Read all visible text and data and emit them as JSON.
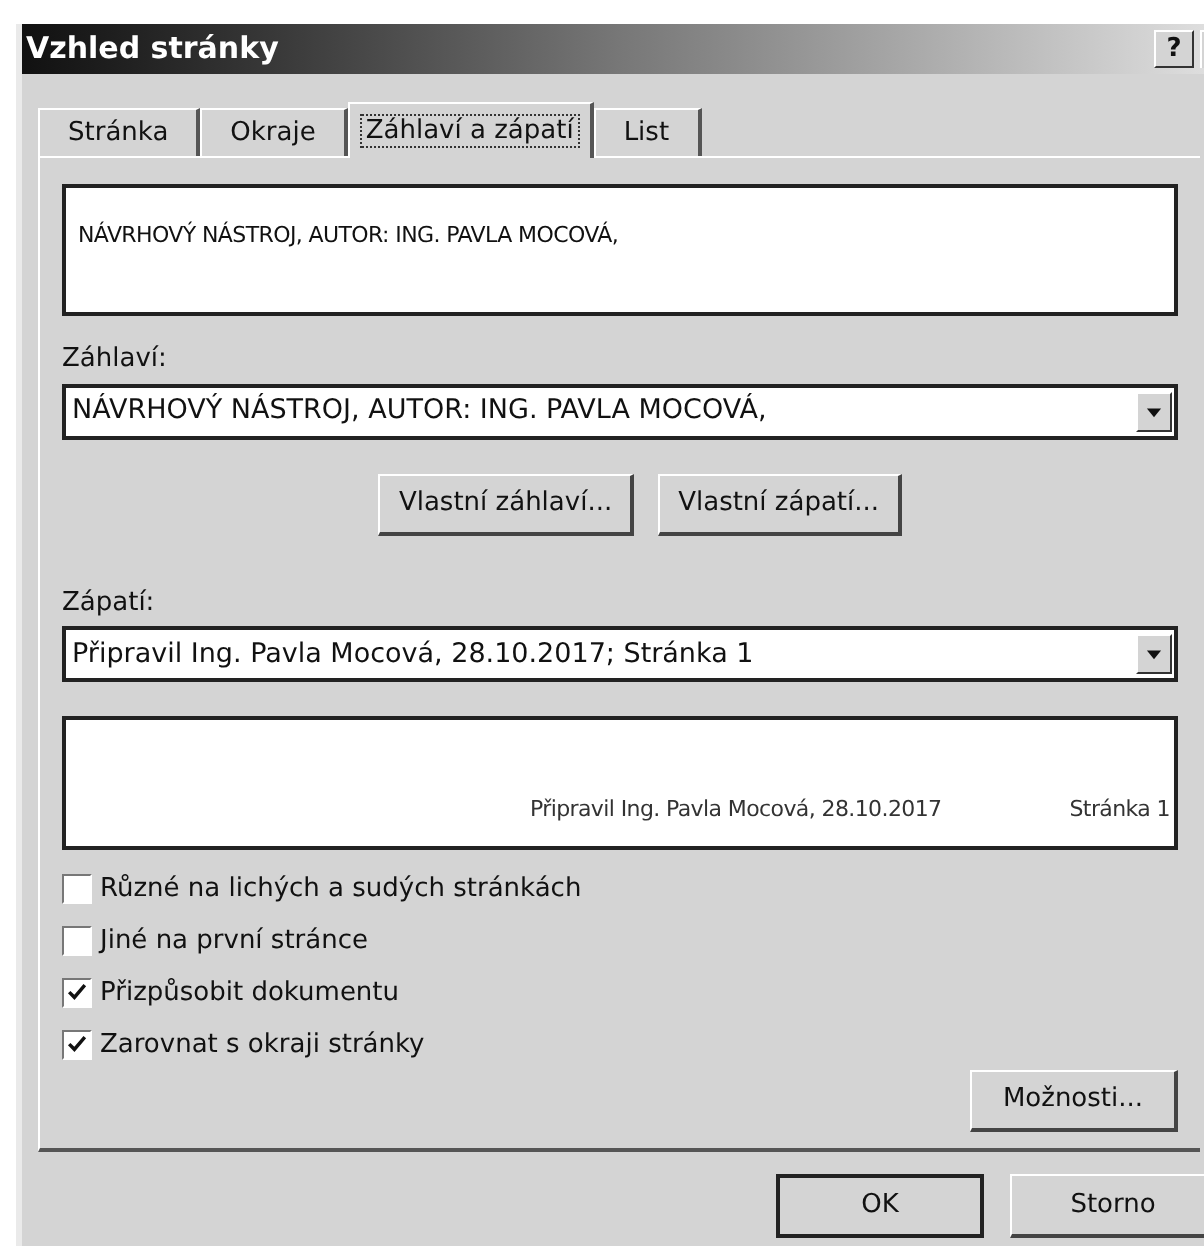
{
  "window": {
    "title": "Vzhled stránky",
    "help_button": "?"
  },
  "tabs": [
    {
      "label": "Stránka",
      "selected": false
    },
    {
      "label": "Okraje",
      "selected": false
    },
    {
      "label": "Záhlaví a zápatí",
      "selected": true
    },
    {
      "label": "List",
      "selected": false
    }
  ],
  "header_preview": {
    "text": "NÁVRHOVÝ NÁSTROJ, AUTOR: ING. PAVLA MOCOVÁ,"
  },
  "header": {
    "label": "Záhlaví:",
    "value": "NÁVRHOVÝ NÁSTROJ, AUTOR: ING. PAVLA MOCOVÁ,"
  },
  "custom_buttons": [
    "Vlastní záhlaví...",
    "Vlastní zápatí..."
  ],
  "footer": {
    "label": "Zápatí:",
    "value": "Připravil Ing. Pavla Mocová, 28.10.2017; Stránka 1"
  },
  "footer_preview": {
    "center": "Připravil Ing. Pavla Mocová, 28.10.2017",
    "right": "Stránka 1"
  },
  "options": [
    {
      "label": "Různé na lichých a sudých stránkách",
      "checked": false
    },
    {
      "label": "Jiné na první stránce",
      "checked": false
    },
    {
      "label": "Přizpůsobit dokumentu",
      "checked": true
    },
    {
      "label": "Zarovnat s okraji stránky",
      "checked": true
    }
  ],
  "options_button": "Možnosti...",
  "buttons": [
    {
      "label": "OK",
      "default": true
    },
    {
      "label": "Storno",
      "default": false
    }
  ]
}
